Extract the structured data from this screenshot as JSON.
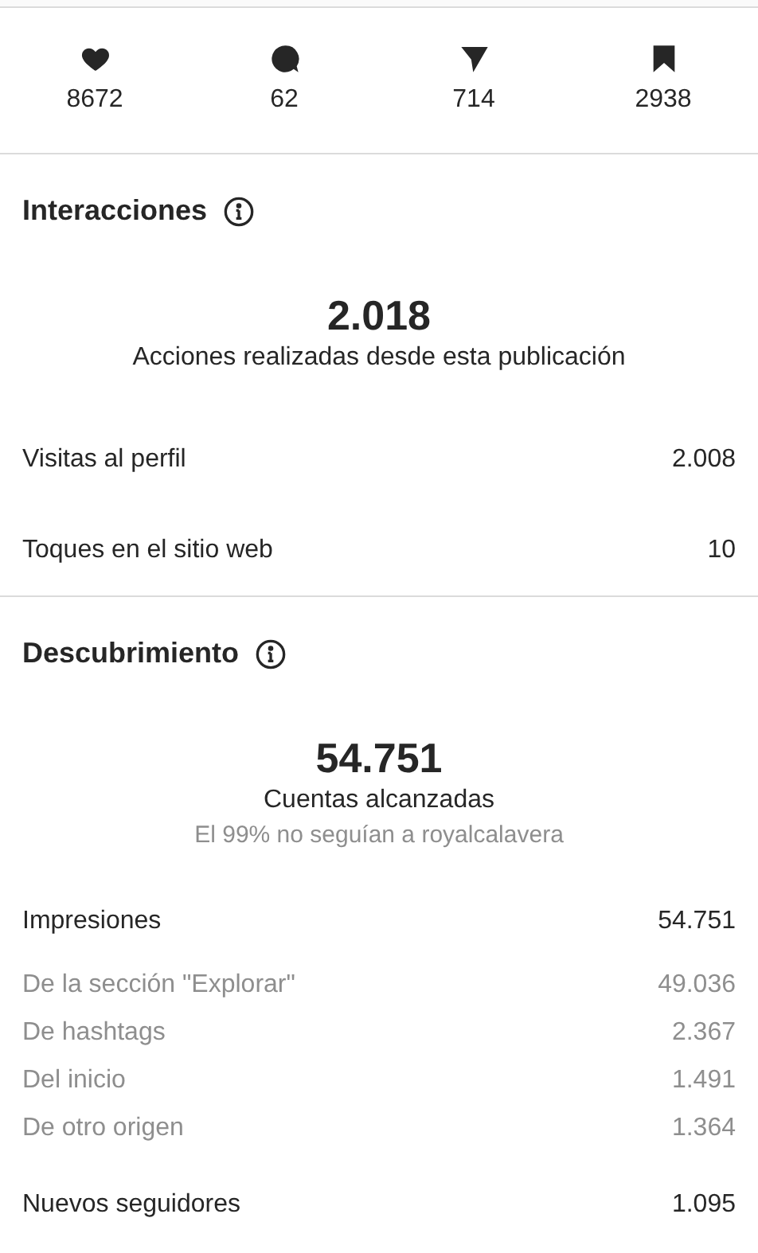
{
  "stats": [
    {
      "kind": "likes",
      "count": "8672"
    },
    {
      "kind": "comments",
      "count": "62"
    },
    {
      "kind": "shares",
      "count": "714"
    },
    {
      "kind": "saves",
      "count": "2938"
    }
  ],
  "sections": [
    {
      "title": "Interacciones",
      "total": "2.018",
      "caption": "Acciones realizadas desde esta publicación",
      "rows": [
        {
          "kind": "main",
          "label": "Visitas al perfil",
          "value": "2.008"
        },
        {
          "kind": "main",
          "label": "Toques en el sitio web",
          "value": "10"
        }
      ]
    },
    {
      "title": "Descubrimiento",
      "total": "54.751",
      "caption": "Cuentas alcanzadas",
      "note": "El 99% no seguían a royalcalavera",
      "rows": [
        {
          "kind": "main",
          "label": "Impresiones",
          "value": "54.751"
        },
        {
          "kind": "sub",
          "label": "De la sección \"Explorar\"",
          "value": "49.036"
        },
        {
          "kind": "sub",
          "label": "De hashtags",
          "value": "2.367"
        },
        {
          "kind": "sub",
          "label": "Del inicio",
          "value": "1.491"
        },
        {
          "kind": "sub",
          "label": "De otro origen",
          "value": "1.364"
        },
        {
          "kind": "main",
          "label": "Nuevos seguidores",
          "value": "1.095"
        }
      ]
    }
  ]
}
